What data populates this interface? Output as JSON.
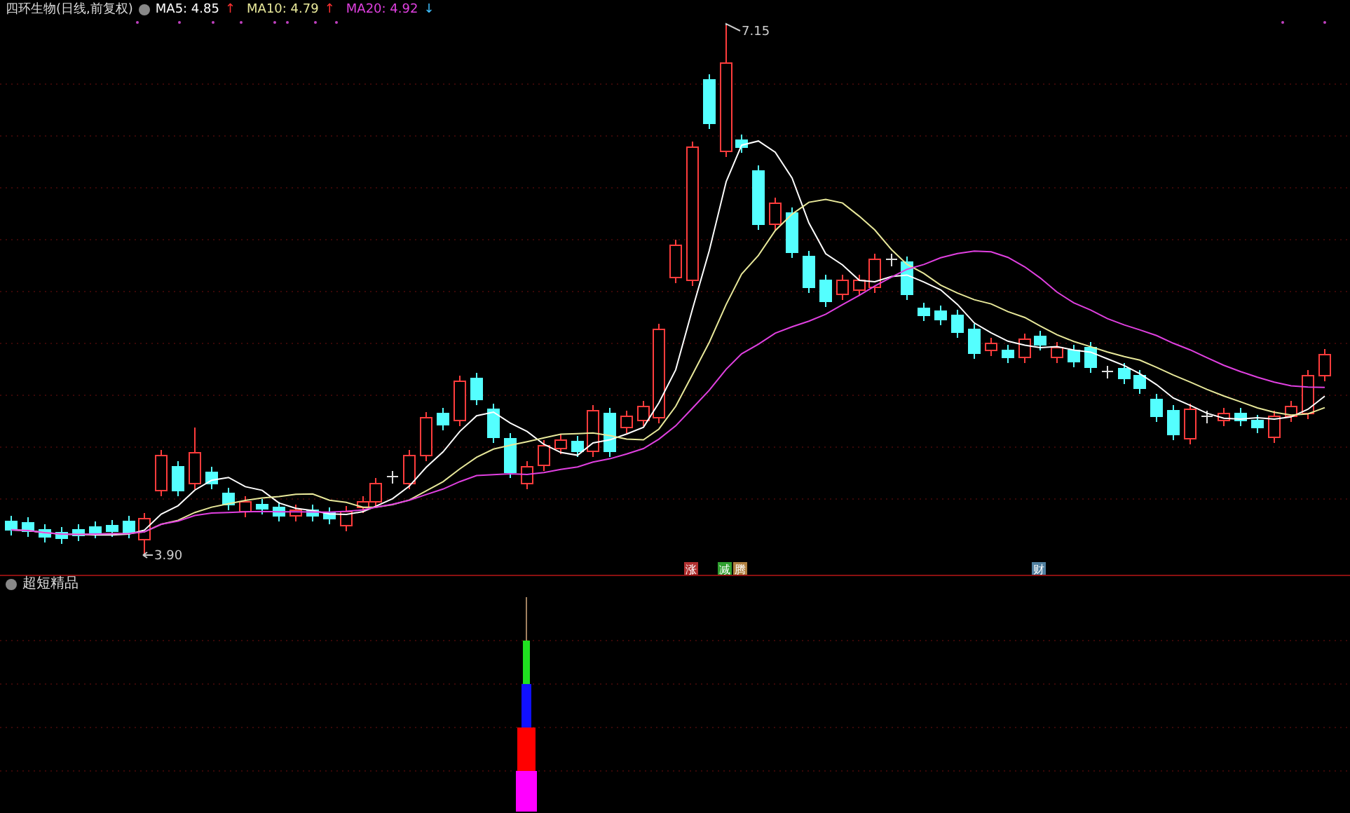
{
  "header": {
    "title": "四环生物(日线,前复权)",
    "indicators": [
      {
        "label": "MA5: 4.85",
        "color": "#ffffff",
        "arrow": {
          "text": "↑",
          "color": "#ff3030"
        }
      },
      {
        "label": "MA10: 4.79",
        "color": "#e8e89a",
        "arrow": {
          "text": "↑",
          "color": "#ff3030"
        }
      },
      {
        "label": "MA20: 4.92",
        "color": "#e040e0",
        "arrow": {
          "text": "↓",
          "color": "#40c0ff"
        }
      }
    ]
  },
  "price_labels": [
    {
      "kind": "high",
      "text": "7.15"
    },
    {
      "kind": "low",
      "text": "3.90"
    }
  ],
  "signal_marks": [
    {
      "text": "涨",
      "color": "#b03030"
    },
    {
      "text": "减",
      "color": "#30a030"
    },
    {
      "text": "腾",
      "color": "#b08040"
    },
    {
      "text": "财",
      "color": "#5080a0"
    }
  ],
  "lower_pane": {
    "title": "超短精品"
  }
}
